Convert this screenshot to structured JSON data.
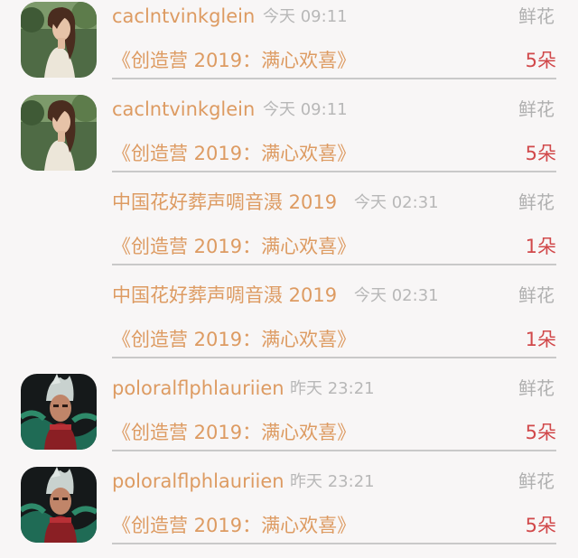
{
  "gifts": [
    {
      "avatar": "woman-portrait-icon",
      "username": "caclntvinkglein",
      "time": "今天 09:11",
      "category": "鲜花",
      "show": "《创造营 2019：满心欢喜》",
      "count": "5朵"
    },
    {
      "avatar": "woman-portrait-icon",
      "username": "caclntvinkglein",
      "time": "今天 09:11",
      "category": "鲜花",
      "show": "《创造营 2019：满心欢喜》",
      "count": "5朵"
    },
    {
      "avatar": "",
      "username": "中国花好葬声啁音滠 2019",
      "time": "今天 02:31",
      "category": "鲜花",
      "show": "《创造营 2019：满心欢喜》",
      "count": "1朵"
    },
    {
      "avatar": "",
      "username": "中国花好葬声啁音滠 2019",
      "time": "今天 02:31",
      "category": "鲜花",
      "show": "《创造营 2019：满心欢喜》",
      "count": "1朵"
    },
    {
      "avatar": "game-character-icon",
      "username": "poloralflphlauriien",
      "time": "昨天 23:21",
      "category": "鲜花",
      "show": "《创造营 2019：满心欢喜》",
      "count": "5朵"
    },
    {
      "avatar": "game-character-icon",
      "username": "poloralflphlauriien",
      "time": "昨天 23:21",
      "category": "鲜花",
      "show": "《创造营 2019：满心欢喜》",
      "count": "5朵"
    }
  ]
}
